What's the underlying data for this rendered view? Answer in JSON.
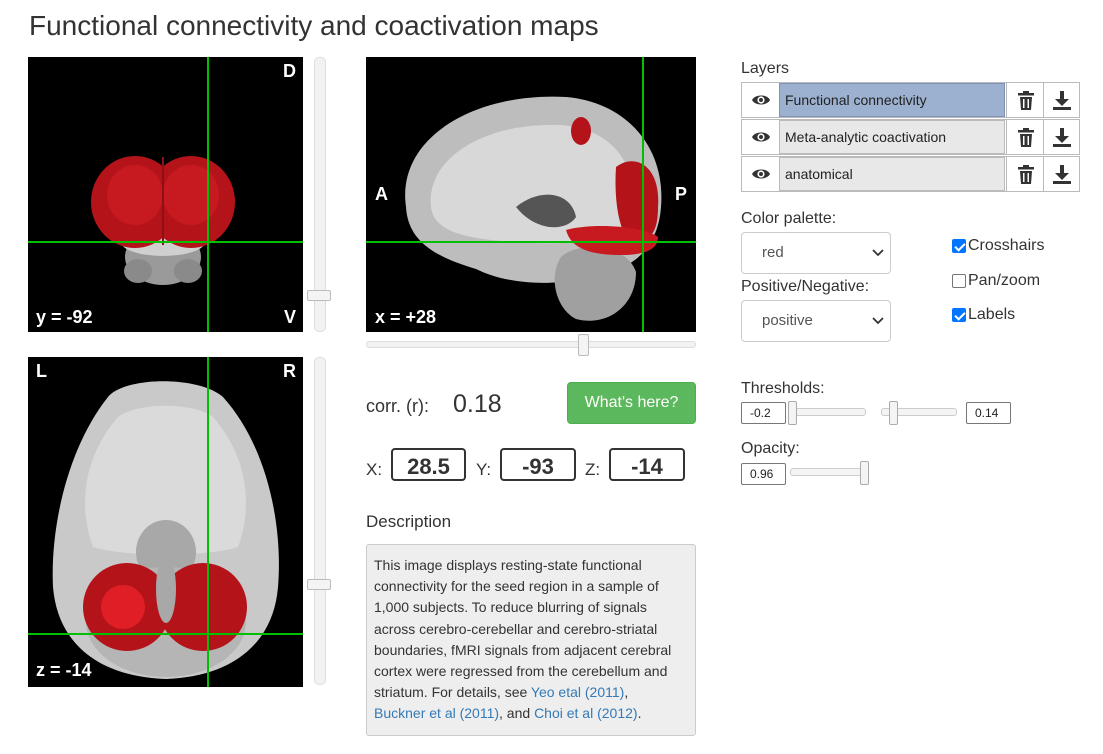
{
  "page_title": "Functional connectivity and coactivation maps",
  "views": {
    "coronal": {
      "coord_label": "y = -92",
      "top": "D",
      "bottom": "V"
    },
    "sagittal": {
      "coord_label": "x = +28",
      "left": "A",
      "right": "P"
    },
    "axial": {
      "coord_label": "z = -14",
      "left": "L",
      "right": "R"
    }
  },
  "correlation": {
    "label": "corr. (r):",
    "value": "0.18"
  },
  "whats_here_button": "What's here?",
  "coords": {
    "x_label": "X:",
    "x_value": "28.5",
    "y_label": "Y:",
    "y_value": "-93",
    "z_label": "Z:",
    "z_value": "-14"
  },
  "description": {
    "label": "Description",
    "text": "This image displays resting-state functional connectivity for the seed region in a sample of 1,000 subjects. To reduce blurring of signals across cerebro-cerebellar and cerebro-striatal boundaries, fMRI signals from adjacent cerebral cortex were regressed from the cerebellum and striatum. For details, see ",
    "link1": "Yeo etal (2011)",
    "sep1": ",",
    "link2": "Buckner et al (2011)",
    "sep2": ", and ",
    "link3": "Choi et al (2012)",
    "end": "."
  },
  "layers": {
    "label": "Layers",
    "items": [
      {
        "name": "Functional connectivity",
        "active": true
      },
      {
        "name": "Meta-analytic coactivation",
        "active": false
      },
      {
        "name": "anatomical",
        "active": false
      }
    ]
  },
  "color_palette": {
    "label": "Color palette:",
    "value": "red"
  },
  "posneg": {
    "label": "Positive/Negative:",
    "value": "positive"
  },
  "checkboxes": {
    "crosshairs": {
      "label": "Crosshairs",
      "checked": true
    },
    "panzoom": {
      "label": "Pan/zoom",
      "checked": false
    },
    "labels": {
      "label": "Labels",
      "checked": true
    }
  },
  "thresholds": {
    "label": "Thresholds:",
    "neg_value": "-0.2",
    "pos_value": "0.14"
  },
  "opacity": {
    "label": "Opacity:",
    "value": "0.96"
  },
  "colors": {
    "overlay": "#c8141b",
    "crosshair": "#00c000",
    "button": "#5cb85c",
    "active_layer": "#9cb1d0",
    "link": "#337ab7"
  },
  "icons": {
    "visibility": "eye-icon",
    "delete": "trash-icon",
    "download": "download-icon"
  }
}
